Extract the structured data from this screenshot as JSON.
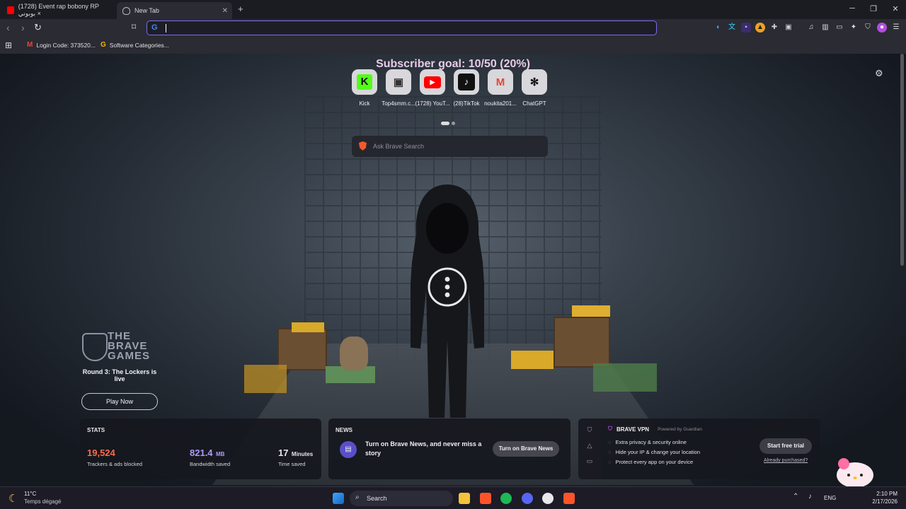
{
  "tabs": [
    {
      "label": "(1728) Event rap bobony RP بوبوني ×",
      "active": false
    },
    {
      "label": "New Tab",
      "active": true
    }
  ],
  "window": {
    "minimize": "─",
    "restore": "❐",
    "close": "✕"
  },
  "address": {
    "value": "",
    "placeholder": ""
  },
  "bookmarks": [
    {
      "label": "Login Code: 373520..."
    },
    {
      "label": "Software Categories..."
    }
  ],
  "newtab": {
    "goal": "Subscriber goal: 10/50 (20%)",
    "sites": [
      {
        "label": "Kick",
        "glyph": "K",
        "color": "#53fc18"
      },
      {
        "label": "Top4smm.c...",
        "glyph": "▣",
        "color": "#222"
      },
      {
        "label": "(1728) YouT...",
        "glyph": "▶",
        "color": "#ff0000"
      },
      {
        "label": "(28)TikTok",
        "glyph": "♪",
        "color": "#111"
      },
      {
        "label": "noukita201...",
        "glyph": "M",
        "color": "#ea4335"
      },
      {
        "label": "ChatGPT",
        "glyph": "✻",
        "color": "#111"
      }
    ],
    "search_placeholder": "Ask Brave Search"
  },
  "games": {
    "logo": "THE BRAVE GAMES",
    "round": "Round 3: The Lockers is live",
    "button": "Play Now"
  },
  "stats": {
    "title": "STATS",
    "items": [
      {
        "value": "19,524",
        "unit": "",
        "label": "Trackers & ads blocked",
        "color": "#ff6b4a"
      },
      {
        "value": "821.4",
        "unit": "MB",
        "label": "Bandwidth saved",
        "color": "#a99cff"
      },
      {
        "value": "17",
        "unit": "Minutes",
        "label": "Time saved",
        "color": "#ffffff"
      }
    ]
  },
  "news": {
    "title": "NEWS",
    "text": "Turn on Brave News, and never miss a story",
    "button": "Turn on Brave News"
  },
  "vpn": {
    "title": "BRAVE VPN",
    "powered": "Powered by  Guardian",
    "features": [
      "Extra privacy & security online",
      "Hide your IP & change your location",
      "Protect every app on your device"
    ],
    "button": "Start free trial",
    "link": "Already purchased?"
  },
  "taskbar": {
    "weather_temp": "11°C",
    "weather_desc": "Temps dégagé",
    "search": "Search",
    "lang": "ENG",
    "time": "2:10 PM",
    "date": "2/17/2026"
  }
}
